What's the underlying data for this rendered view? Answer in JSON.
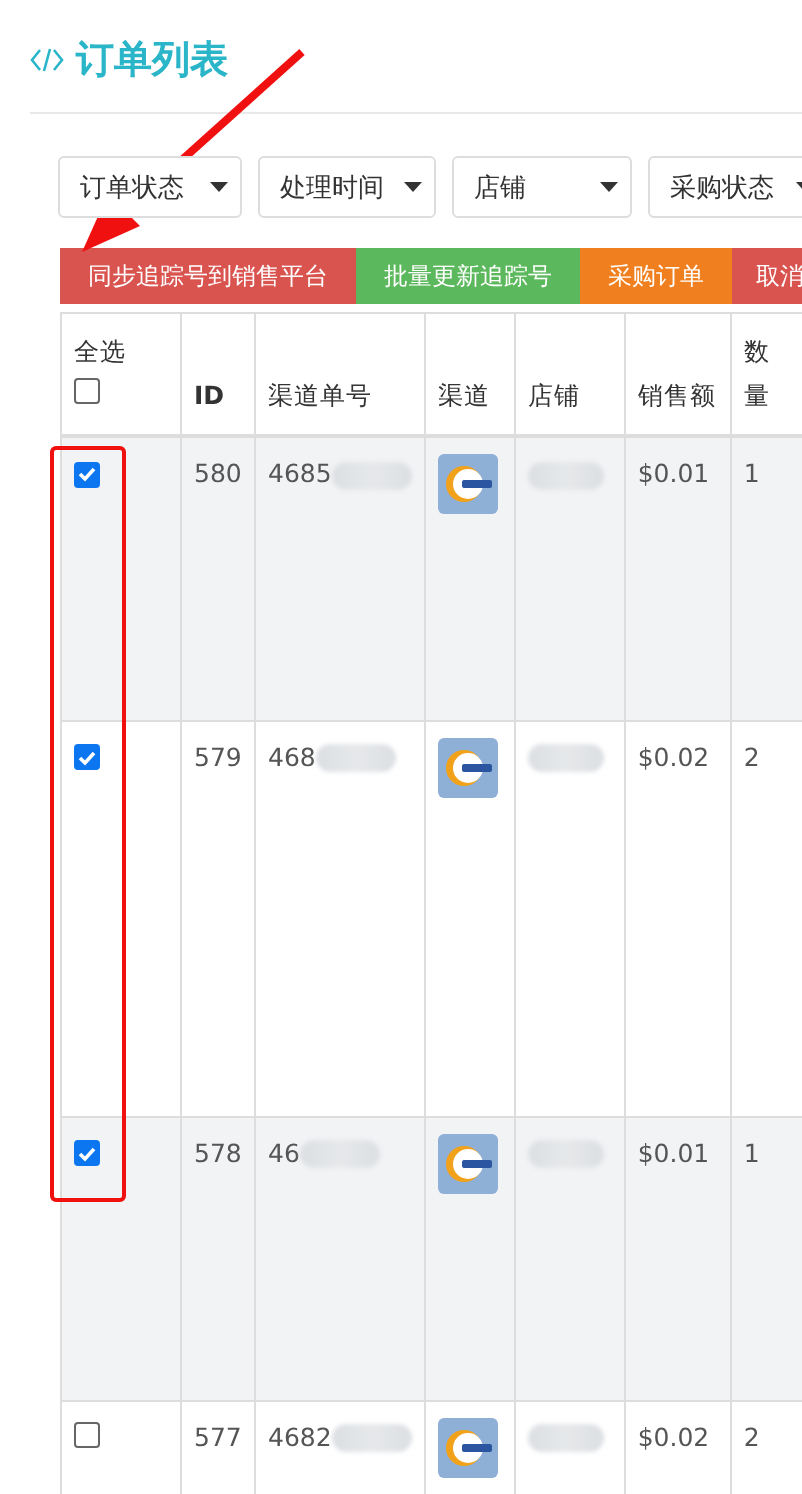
{
  "page": {
    "title": "订单列表"
  },
  "filters": [
    {
      "label": "订单状态"
    },
    {
      "label": "处理时间"
    },
    {
      "label": "店铺"
    },
    {
      "label": "采购状态"
    }
  ],
  "actions": [
    {
      "label": "同步追踪号到销售平台",
      "kind": "danger"
    },
    {
      "label": "批量更新追踪号",
      "kind": "success"
    },
    {
      "label": "采购订单",
      "kind": "warning"
    },
    {
      "label": "取消",
      "kind": "danger"
    }
  ],
  "table": {
    "select_all": {
      "label": "全选",
      "checked": false
    },
    "columns": [
      "ID",
      "渠道单号",
      "渠道",
      "店铺",
      "销售额",
      "数量"
    ],
    "rows": [
      {
        "checked": true,
        "id": "580",
        "order_no": "4685",
        "amount": "$0.01",
        "quantity": "1"
      },
      {
        "checked": true,
        "id": "579",
        "order_no": "468",
        "amount": "$0.02",
        "quantity": "2"
      },
      {
        "checked": true,
        "id": "578",
        "order_no": "46",
        "amount": "$0.01",
        "quantity": "1"
      },
      {
        "checked": false,
        "id": "577",
        "order_no": "4682",
        "amount": "$0.02",
        "quantity": "2"
      }
    ]
  }
}
